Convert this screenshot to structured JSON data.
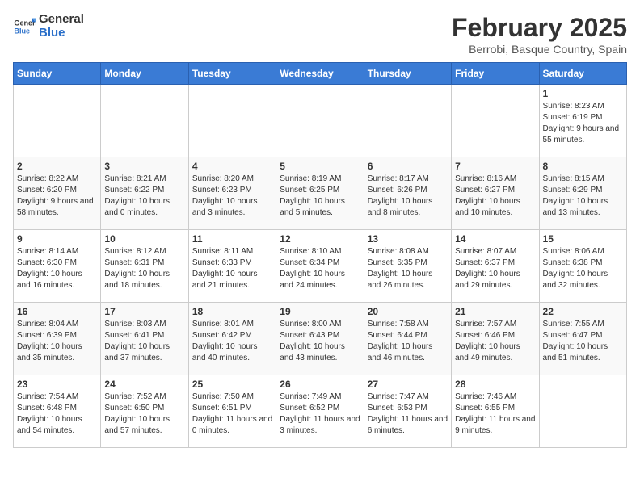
{
  "header": {
    "logo_general": "General",
    "logo_blue": "Blue",
    "month_title": "February 2025",
    "subtitle": "Berrobi, Basque Country, Spain"
  },
  "days_of_week": [
    "Sunday",
    "Monday",
    "Tuesday",
    "Wednesday",
    "Thursday",
    "Friday",
    "Saturday"
  ],
  "weeks": [
    [
      {
        "day": "",
        "info": ""
      },
      {
        "day": "",
        "info": ""
      },
      {
        "day": "",
        "info": ""
      },
      {
        "day": "",
        "info": ""
      },
      {
        "day": "",
        "info": ""
      },
      {
        "day": "",
        "info": ""
      },
      {
        "day": "1",
        "info": "Sunrise: 8:23 AM\nSunset: 6:19 PM\nDaylight: 9 hours and 55 minutes."
      }
    ],
    [
      {
        "day": "2",
        "info": "Sunrise: 8:22 AM\nSunset: 6:20 PM\nDaylight: 9 hours and 58 minutes."
      },
      {
        "day": "3",
        "info": "Sunrise: 8:21 AM\nSunset: 6:22 PM\nDaylight: 10 hours and 0 minutes."
      },
      {
        "day": "4",
        "info": "Sunrise: 8:20 AM\nSunset: 6:23 PM\nDaylight: 10 hours and 3 minutes."
      },
      {
        "day": "5",
        "info": "Sunrise: 8:19 AM\nSunset: 6:25 PM\nDaylight: 10 hours and 5 minutes."
      },
      {
        "day": "6",
        "info": "Sunrise: 8:17 AM\nSunset: 6:26 PM\nDaylight: 10 hours and 8 minutes."
      },
      {
        "day": "7",
        "info": "Sunrise: 8:16 AM\nSunset: 6:27 PM\nDaylight: 10 hours and 10 minutes."
      },
      {
        "day": "8",
        "info": "Sunrise: 8:15 AM\nSunset: 6:29 PM\nDaylight: 10 hours and 13 minutes."
      }
    ],
    [
      {
        "day": "9",
        "info": "Sunrise: 8:14 AM\nSunset: 6:30 PM\nDaylight: 10 hours and 16 minutes."
      },
      {
        "day": "10",
        "info": "Sunrise: 8:12 AM\nSunset: 6:31 PM\nDaylight: 10 hours and 18 minutes."
      },
      {
        "day": "11",
        "info": "Sunrise: 8:11 AM\nSunset: 6:33 PM\nDaylight: 10 hours and 21 minutes."
      },
      {
        "day": "12",
        "info": "Sunrise: 8:10 AM\nSunset: 6:34 PM\nDaylight: 10 hours and 24 minutes."
      },
      {
        "day": "13",
        "info": "Sunrise: 8:08 AM\nSunset: 6:35 PM\nDaylight: 10 hours and 26 minutes."
      },
      {
        "day": "14",
        "info": "Sunrise: 8:07 AM\nSunset: 6:37 PM\nDaylight: 10 hours and 29 minutes."
      },
      {
        "day": "15",
        "info": "Sunrise: 8:06 AM\nSunset: 6:38 PM\nDaylight: 10 hours and 32 minutes."
      }
    ],
    [
      {
        "day": "16",
        "info": "Sunrise: 8:04 AM\nSunset: 6:39 PM\nDaylight: 10 hours and 35 minutes."
      },
      {
        "day": "17",
        "info": "Sunrise: 8:03 AM\nSunset: 6:41 PM\nDaylight: 10 hours and 37 minutes."
      },
      {
        "day": "18",
        "info": "Sunrise: 8:01 AM\nSunset: 6:42 PM\nDaylight: 10 hours and 40 minutes."
      },
      {
        "day": "19",
        "info": "Sunrise: 8:00 AM\nSunset: 6:43 PM\nDaylight: 10 hours and 43 minutes."
      },
      {
        "day": "20",
        "info": "Sunrise: 7:58 AM\nSunset: 6:44 PM\nDaylight: 10 hours and 46 minutes."
      },
      {
        "day": "21",
        "info": "Sunrise: 7:57 AM\nSunset: 6:46 PM\nDaylight: 10 hours and 49 minutes."
      },
      {
        "day": "22",
        "info": "Sunrise: 7:55 AM\nSunset: 6:47 PM\nDaylight: 10 hours and 51 minutes."
      }
    ],
    [
      {
        "day": "23",
        "info": "Sunrise: 7:54 AM\nSunset: 6:48 PM\nDaylight: 10 hours and 54 minutes."
      },
      {
        "day": "24",
        "info": "Sunrise: 7:52 AM\nSunset: 6:50 PM\nDaylight: 10 hours and 57 minutes."
      },
      {
        "day": "25",
        "info": "Sunrise: 7:50 AM\nSunset: 6:51 PM\nDaylight: 11 hours and 0 minutes."
      },
      {
        "day": "26",
        "info": "Sunrise: 7:49 AM\nSunset: 6:52 PM\nDaylight: 11 hours and 3 minutes."
      },
      {
        "day": "27",
        "info": "Sunrise: 7:47 AM\nSunset: 6:53 PM\nDaylight: 11 hours and 6 minutes."
      },
      {
        "day": "28",
        "info": "Sunrise: 7:46 AM\nSunset: 6:55 PM\nDaylight: 11 hours and 9 minutes."
      },
      {
        "day": "",
        "info": ""
      }
    ]
  ]
}
